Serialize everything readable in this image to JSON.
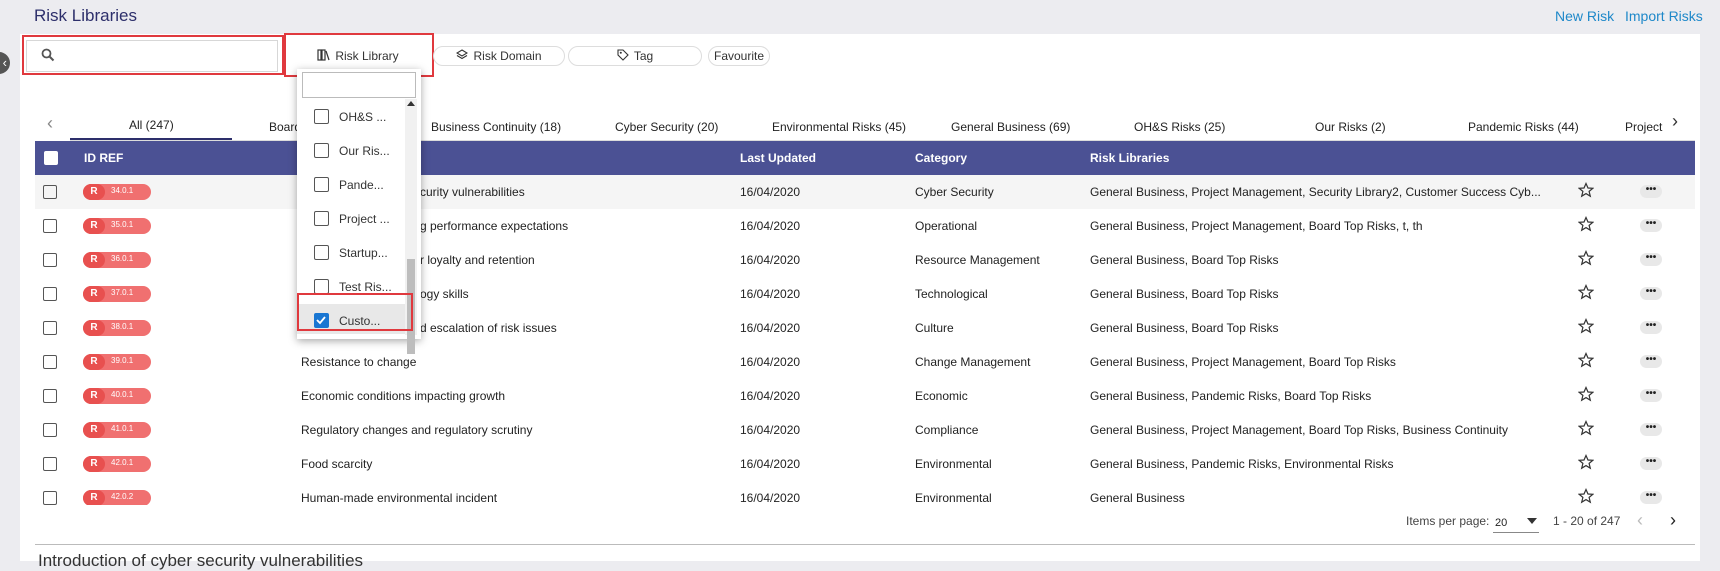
{
  "header": {
    "title": "Risk Libraries",
    "new_risk": "New Risk",
    "import_risks": "Import Risks"
  },
  "filters": {
    "search_placeholder": "",
    "risk_library": "Risk Library",
    "risk_domain": "Risk Domain",
    "tag": "Tag",
    "favourite": "Favourite"
  },
  "tabs": [
    "All (247)",
    "Board",
    "Business Continuity (18)",
    "Cyber Security (20)",
    "Environmental Risks (45)",
    "General Business (69)",
    "OH&S Risks (25)",
    "Our Risks (2)",
    "Pandemic Risks (44)",
    "Project"
  ],
  "table": {
    "headers": {
      "id_ref": "ID REF",
      "last_updated": "Last Updated",
      "category": "Category",
      "risk_libraries": "Risk Libraries"
    },
    "badge_letter": "R",
    "rows": [
      {
        "id": "34.0.1",
        "title": "curity vulnerabilities",
        "updated": "16/04/2020",
        "category": "Cyber Security",
        "libraries": "General Business, Project Management, Security Library2, Customer Success Cyb..."
      },
      {
        "id": "35.0.1",
        "title": "g performance expectations",
        "updated": "16/04/2020",
        "category": "Operational",
        "libraries": "General Business, Project Management, Board Top Risks, t, th"
      },
      {
        "id": "36.0.1",
        "title": "r loyalty and retention",
        "updated": "16/04/2020",
        "category": "Resource Management",
        "libraries": "General Business, Board Top Risks"
      },
      {
        "id": "37.0.1",
        "title": "ogy skills",
        "updated": "16/04/2020",
        "category": "Technological",
        "libraries": "General Business, Board Top Risks"
      },
      {
        "id": "38.0.1",
        "title": "d escalation of risk issues",
        "updated": "16/04/2020",
        "category": "Culture",
        "libraries": "General Business, Board Top Risks"
      },
      {
        "id": "39.0.1",
        "title": "Resistance to change",
        "updated": "16/04/2020",
        "category": "Change Management",
        "libraries": "General Business, Project Management, Board Top Risks"
      },
      {
        "id": "40.0.1",
        "title": "Economic conditions impacting growth",
        "updated": "16/04/2020",
        "category": "Economic",
        "libraries": "General Business, Pandemic Risks, Board Top Risks"
      },
      {
        "id": "41.0.1",
        "title": "Regulatory changes and regulatory scrutiny",
        "updated": "16/04/2020",
        "category": "Compliance",
        "libraries": "General Business, Project Management, Board Top Risks, Business Continuity"
      },
      {
        "id": "42.0.1",
        "title": "Food scarcity",
        "updated": "16/04/2020",
        "category": "Environmental",
        "libraries": "General Business, Pandemic Risks, Environmental Risks"
      },
      {
        "id": "42.0.2",
        "title": "Human-made environmental incident",
        "updated": "16/04/2020",
        "category": "Environmental",
        "libraries": "General Business"
      }
    ]
  },
  "dropdown": {
    "search_value": "",
    "items": [
      {
        "label": "OH&S ...",
        "checked": false
      },
      {
        "label": "Our Ris...",
        "checked": false
      },
      {
        "label": "Pande...",
        "checked": false
      },
      {
        "label": "Project ...",
        "checked": false
      },
      {
        "label": "Startup...",
        "checked": false
      },
      {
        "label": "Test Ris...",
        "checked": false
      },
      {
        "label": "Custo...",
        "checked": true
      }
    ]
  },
  "pagination": {
    "items_per_page_label": "Items per page:",
    "items_per_page": "20",
    "range": "1 - 20 of 247"
  },
  "detail_title": "Introduction of cyber security vulnerabilities",
  "colors": {
    "header_bg": "#4b5194",
    "accent_link": "#1e88c9",
    "badge": "#e8504f",
    "highlight": "#e0393e"
  }
}
